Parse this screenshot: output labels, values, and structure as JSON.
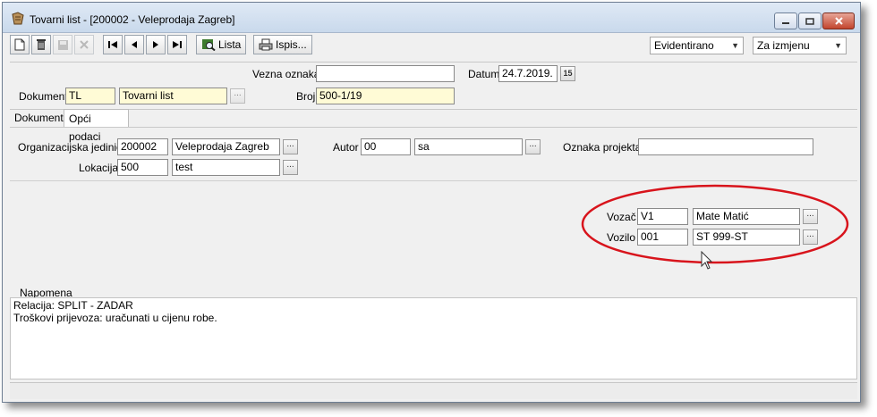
{
  "window": {
    "title": "Tovarni list - [200002 - Veleprodaja Zagreb]",
    "buttons": {
      "minimize": "minimize",
      "maximize": "maximize",
      "close": "close"
    }
  },
  "toolbar": {
    "lista_label": "Lista",
    "ispis_label": "Ispis...",
    "status_select": "Evidentirano",
    "mode_select": "Za izmjenu"
  },
  "header": {
    "vezna_oznaka_label": "Vezna oznaka",
    "vezna_oznaka_value": "",
    "datum_label": "Datum",
    "datum_value": "24.7.2019.",
    "calendar_day": "15",
    "dokument_label": "Dokument",
    "dokument_code": "TL",
    "dokument_name": "Tovarni list",
    "broj_label": "Broj",
    "broj_value": "500-1/19"
  },
  "tabs": [
    {
      "label": "Dokumenti"
    },
    {
      "label": "Opći podaci"
    }
  ],
  "general": {
    "org_label": "Organizacijska jedinica",
    "org_code": "200002",
    "org_name": "Veleprodaja Zagreb",
    "lokacija_label": "Lokacija",
    "lokacija_code": "500",
    "lokacija_name": "test",
    "autor_label": "Autor",
    "autor_code": "00",
    "autor_name": "sa",
    "oznaka_projekta_label": "Oznaka projekta",
    "oznaka_projekta_value": ""
  },
  "transport": {
    "vozac_label": "Vozač",
    "vozac_code": "V1",
    "vozac_name": "Mate Matić",
    "vozilo_label": "Vozilo",
    "vozilo_code": "001",
    "vozilo_name": "ST 999-ST",
    "highlight_color": "#d8141c"
  },
  "napomena": {
    "label": "Napomena",
    "line1": "Relacija: SPLIT - ZADAR",
    "line2": "Troškovi prijevoza: uračunati u cijenu robe."
  },
  "lookup_glyph": "..."
}
